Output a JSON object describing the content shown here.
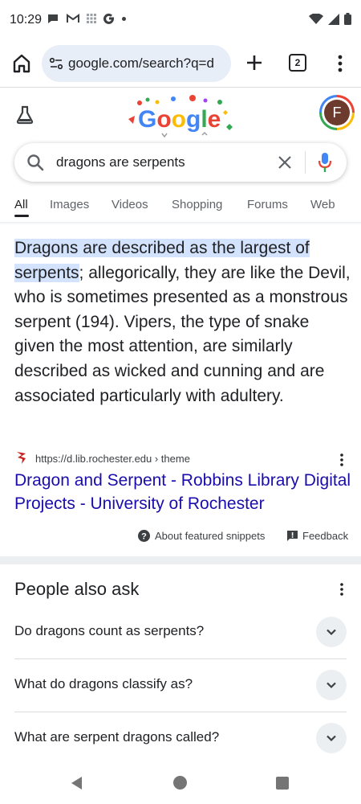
{
  "status_bar": {
    "time": "10:29",
    "left_icons": [
      "chat-bubble-icon",
      "gmail-icon",
      "grid-icon",
      "google-g-icon",
      "dot-icon"
    ],
    "right_icons": [
      "wifi-icon",
      "signal-icon",
      "battery-icon"
    ]
  },
  "browser": {
    "url": "google.com/search?q=d",
    "tab_count": "2"
  },
  "search": {
    "query": "dragons are serpents"
  },
  "tabs": [
    {
      "label": "All",
      "active": true
    },
    {
      "label": "Images"
    },
    {
      "label": "Videos"
    },
    {
      "label": "Shopping"
    },
    {
      "label": "Forums"
    },
    {
      "label": "Web"
    }
  ],
  "featured_snippet": {
    "highlight": "Dragons are described as the largest of serpents",
    "rest": "; allegorically, they are like the Devil, who is sometimes presented as a monstrous serpent (194). Vipers, the type of snake given the most attention, are similarly described as wicked and cunning and are associated particularly with adultery.",
    "source_url": "https://d.lib.rochester.edu › theme",
    "source_title": "Dragon and Serpent - Robbins Library Digital Projects - University of Rochester",
    "about_label": "About featured snippets",
    "feedback_label": "Feedback"
  },
  "people_also_ask": {
    "title": "People also ask",
    "questions": [
      "Do dragons count as serpents?",
      "What do dragons classify as?",
      "What are serpent dragons called?"
    ]
  },
  "profile": {
    "initial": "F"
  },
  "colors": {
    "link": "#1a0dab",
    "highlight": "#d3e3fd",
    "urlbar_bg": "#e8eef7",
    "mic_blue": "#4285f4",
    "mic_red": "#ea4335"
  }
}
